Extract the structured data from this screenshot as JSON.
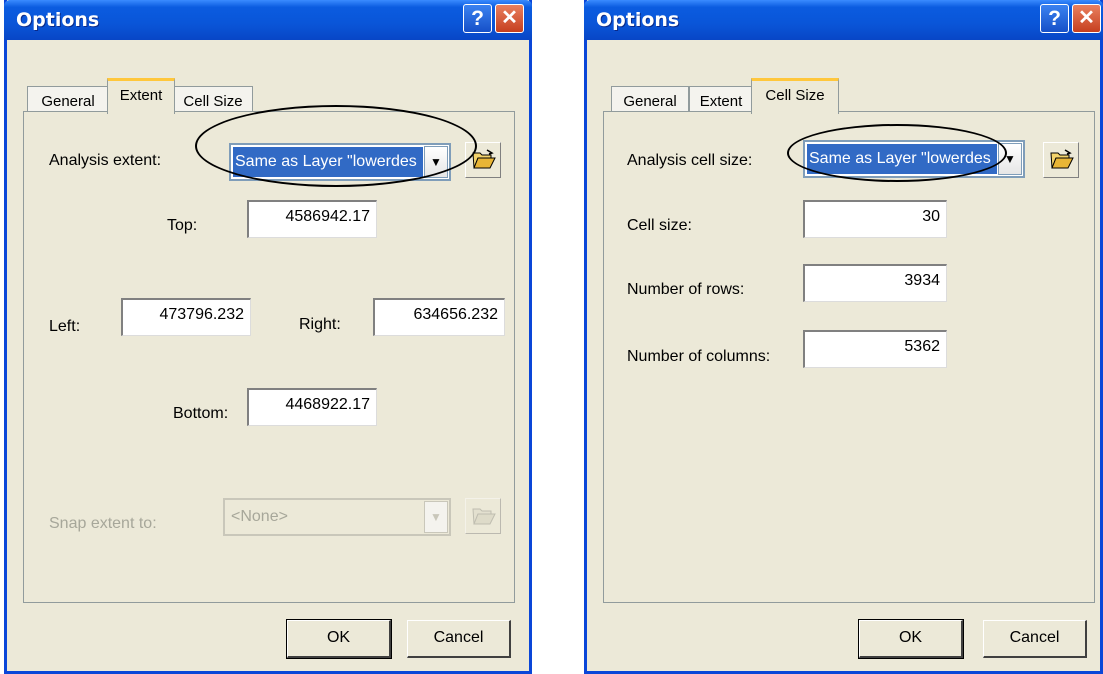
{
  "dialogs": [
    {
      "title": "Options",
      "tabs": [
        "General",
        "Extent",
        "Cell Size"
      ],
      "active_tab": "Extent",
      "analysis_extent_label": "Analysis extent:",
      "analysis_extent_value": "Same as Layer \"lowerdes",
      "top_label": "Top:",
      "top_value": "4586942.17",
      "left_label": "Left:",
      "left_value": "473796.232",
      "right_label": "Right:",
      "right_value": "634656.232",
      "bottom_label": "Bottom:",
      "bottom_value": "4468922.17",
      "snap_label": "Snap extent to:",
      "snap_value": "<None>",
      "ok_label": "OK",
      "cancel_label": "Cancel"
    },
    {
      "title": "Options",
      "tabs": [
        "General",
        "Extent",
        "Cell Size"
      ],
      "active_tab": "Cell Size",
      "cell_size_combo_label": "Analysis cell size:",
      "cell_size_combo_value": "Same as Layer \"lowerdes",
      "cell_size_label": "Cell size:",
      "cell_size_value": "30",
      "rows_label": "Number of rows:",
      "rows_value": "3934",
      "columns_label": "Number of columns:",
      "columns_value": "5362",
      "ok_label": "OK",
      "cancel_label": "Cancel"
    }
  ],
  "icons": {
    "help": "help-icon",
    "close": "close-icon",
    "folder": "open-folder-icon",
    "dropdown": "dropdown-arrow-icon"
  }
}
